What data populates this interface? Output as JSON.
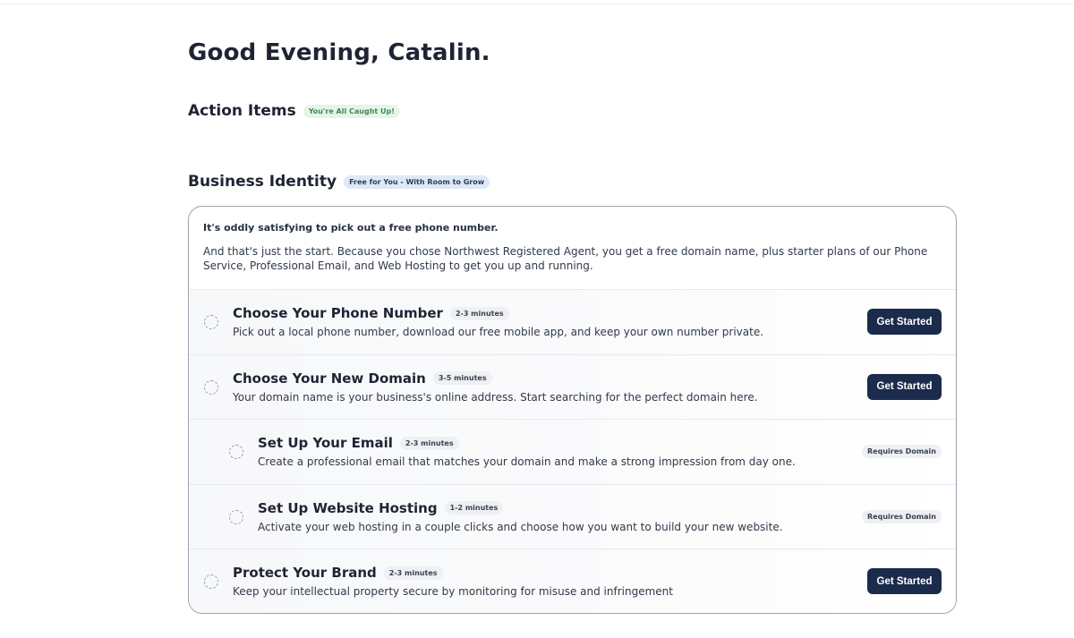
{
  "greeting": "Good Evening, Catalin.",
  "action_items": {
    "title": "Action Items",
    "badge": "You're All Caught Up!"
  },
  "business_identity": {
    "title": "Business Identity",
    "badge": "Free for You - With Room to Grow",
    "intro_title": "It's oddly satisfying to pick out a free phone number.",
    "intro_body": "And that's just the start. Because you chose Northwest Registered Agent, you get a free domain name, plus starter plans of our Phone Service, Professional Email, and Web Hosting to get you up and running.",
    "tasks": [
      {
        "title": "Choose Your Phone Number",
        "time": "2-3 minutes",
        "desc": "Pick out a local phone number, download our free mobile app, and keep your own number private.",
        "action": "Get Started"
      },
      {
        "title": "Choose Your New Domain",
        "time": "3-5 minutes",
        "desc": "Your domain name is your business's online address. Start searching for the perfect domain here.",
        "action": "Get Started"
      },
      {
        "title": "Set Up Your Email",
        "time": "2-3 minutes",
        "desc": "Create a professional email that matches your domain and make a strong impression from day one.",
        "action": "Requires Domain"
      },
      {
        "title": "Set Up Website Hosting",
        "time": "1-2 minutes",
        "desc": "Activate your web hosting in a couple clicks and choose how you want to build your new website.",
        "action": "Requires Domain"
      },
      {
        "title": "Protect Your Brand",
        "time": "2-3 minutes",
        "desc": "Keep your intellectual property secure by monitoring for misuse and infringement",
        "action": "Get Started"
      }
    ]
  }
}
